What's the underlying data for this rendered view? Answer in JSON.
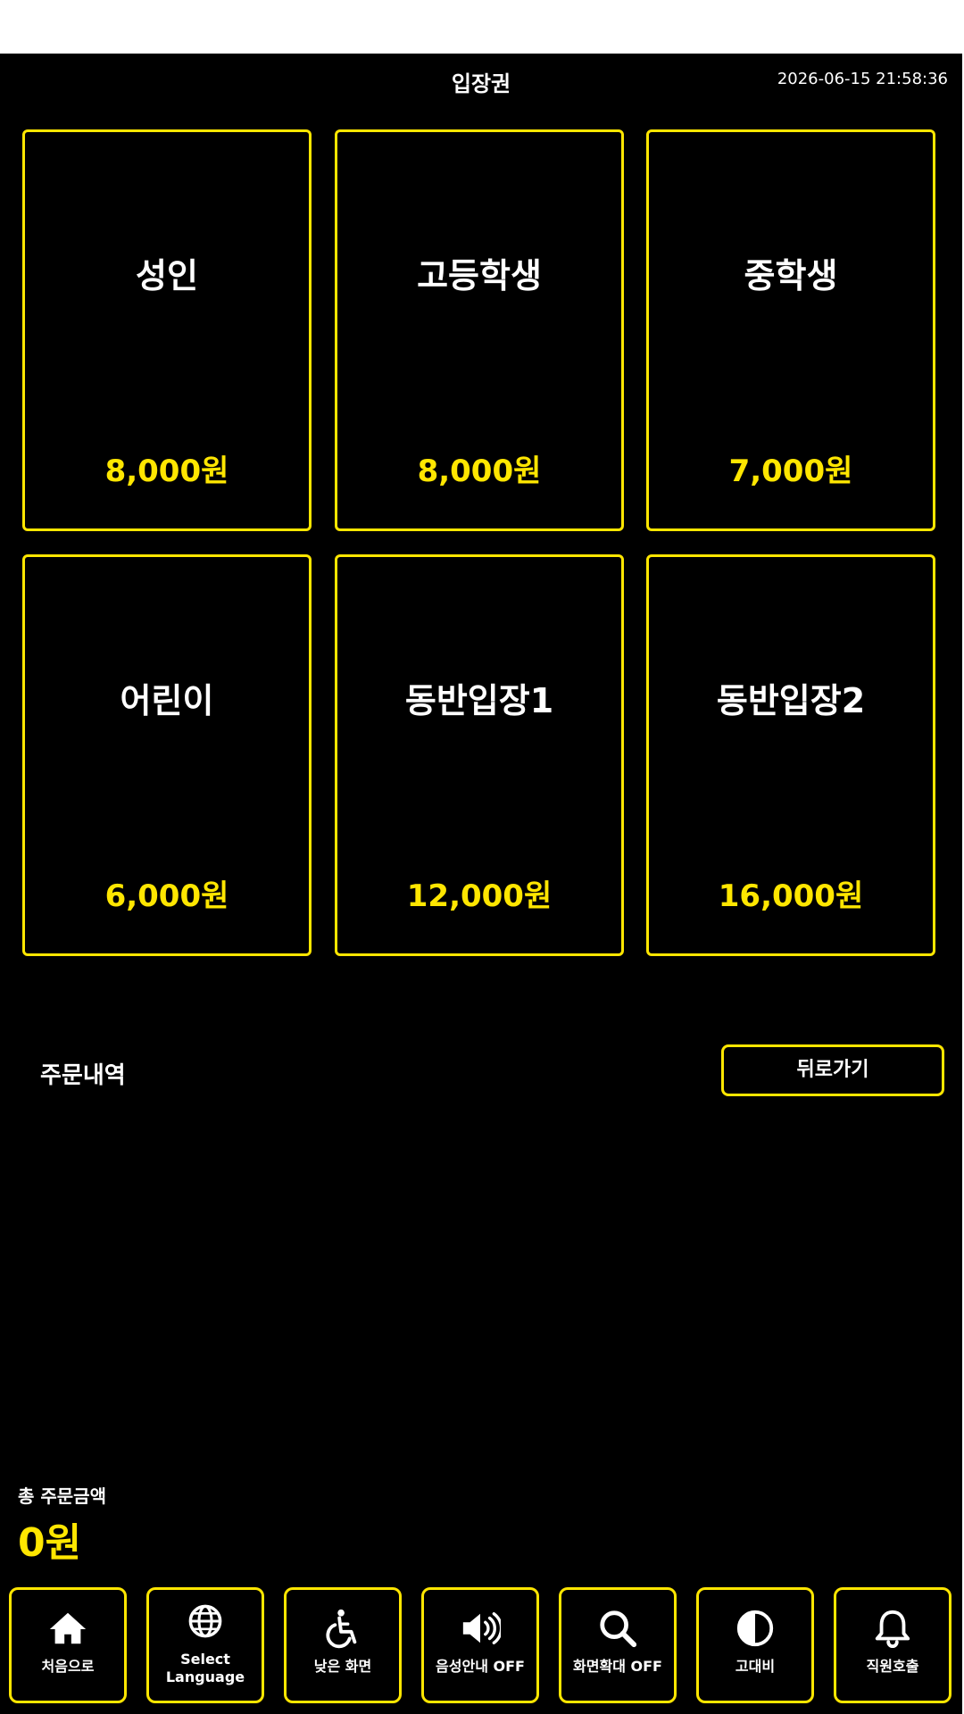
{
  "header": {
    "title": "입장권",
    "datetime": "2026-06-15 21:58:36"
  },
  "tickets": [
    {
      "name": "성인",
      "price": "8,000원"
    },
    {
      "name": "고등학생",
      "price": "8,000원"
    },
    {
      "name": "중학생",
      "price": "7,000원"
    },
    {
      "name": "어린이",
      "price": "6,000원"
    },
    {
      "name": "동반입장1",
      "price": "12,000원"
    },
    {
      "name": "동반입장2",
      "price": "16,000원"
    }
  ],
  "order": {
    "title": "주문내역",
    "back_label": "뒤로가기",
    "items": []
  },
  "total": {
    "label": "총 주문금액",
    "amount": "0원"
  },
  "bottom_bar": [
    {
      "icon": "home-icon",
      "label": "처음으로"
    },
    {
      "icon": "globe-icon",
      "label": "Select Language"
    },
    {
      "icon": "wheelchair-icon",
      "label": "낮은 화면"
    },
    {
      "icon": "speaker-icon",
      "label": "음성안내 OFF"
    },
    {
      "icon": "magnifier-icon",
      "label": "화면확대 OFF"
    },
    {
      "icon": "contrast-icon",
      "label": "고대비"
    },
    {
      "icon": "bell-icon",
      "label": "직원호출"
    }
  ],
  "colors": {
    "background": "#000000",
    "accent": "#ffe600",
    "text": "#ffffff"
  }
}
